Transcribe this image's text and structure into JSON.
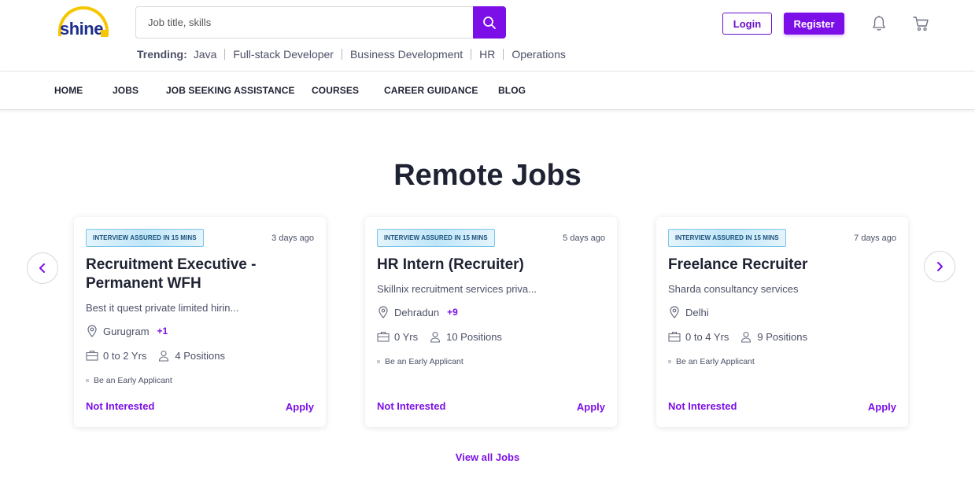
{
  "brand": {
    "logo_text": "shine",
    "accent": "#7c0fe8",
    "logo_yellow": "#f6c600"
  },
  "search": {
    "placeholder": "Job title, skills",
    "value": ""
  },
  "trending": {
    "label": "Trending:",
    "items": [
      "Java",
      "Full-stack Developer",
      "Business Development",
      "HR",
      "Operations"
    ]
  },
  "auth": {
    "login_label": "Login",
    "register_label": "Register"
  },
  "icons": {
    "search": "search-icon",
    "bell": "bell-icon",
    "cart": "cart-icon",
    "prev": "chevron-left-icon",
    "next": "chevron-right-icon"
  },
  "nav": {
    "items": [
      "HOME",
      "JOBS",
      "JOB SEEKING ASSISTANCE",
      "COURSES",
      "CAREER GUIDANCE",
      "BLOG"
    ]
  },
  "main": {
    "title": "Remote Jobs",
    "view_all_label": "View all Jobs",
    "cards": [
      {
        "badge": "INTERVIEW ASSURED IN 15 MINS",
        "posted": "3 days ago",
        "title": "Recruitment Executive - Permanent WFH",
        "company": "Best it quest private limited hirin...",
        "location": "Gurugram",
        "location_more": "+1",
        "experience": "0 to 2 Yrs",
        "positions": "4 Positions",
        "tag": "Be an Early Applicant",
        "not_interested": "Not Interested",
        "apply": "Apply"
      },
      {
        "badge": "INTERVIEW ASSURED IN 15 MINS",
        "posted": "5 days ago",
        "title": "HR Intern (Recruiter)",
        "company": "Skillnix recruitment services priva...",
        "location": "Dehradun",
        "location_more": "+9",
        "experience": "0 Yrs",
        "positions": "10 Positions",
        "tag": "Be an Early Applicant",
        "not_interested": "Not Interested",
        "apply": "Apply"
      },
      {
        "badge": "INTERVIEW ASSURED IN 15 MINS",
        "posted": "7 days ago",
        "title": "Freelance Recruiter",
        "company": "Sharda consultancy services",
        "location": "Delhi",
        "location_more": "",
        "experience": "0 to 4 Yrs",
        "positions": "9 Positions",
        "tag": "Be an Early Applicant",
        "not_interested": "Not Interested",
        "apply": "Apply"
      }
    ]
  }
}
